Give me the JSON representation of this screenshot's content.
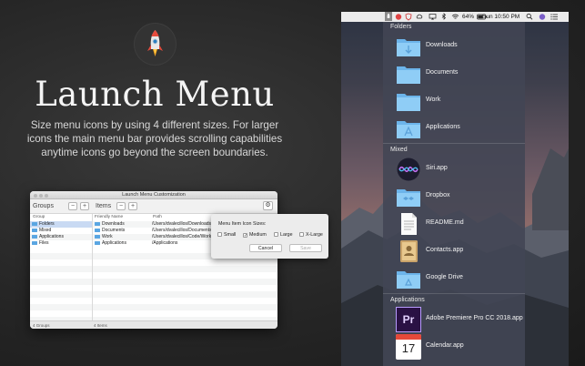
{
  "promo": {
    "title": "Launch Menu",
    "description": "Size menu icons by using 4 different sizes. For larger icons the main menu bar provides scrolling capabilities anytime icons go beyond the screen boundaries."
  },
  "window": {
    "title": "Launch Menu Customization",
    "groups_label": "Groups",
    "items_label": "Items",
    "minus": "−",
    "plus": "+",
    "gear": "⚙",
    "group_column": "Group",
    "item_columns": [
      "Friendly Name",
      "Path"
    ],
    "groups": [
      "Folders",
      "Mixed",
      "Applications",
      "Files"
    ],
    "items": [
      {
        "name": "Downloads",
        "path": "/Users/dvalecillos/Downloads"
      },
      {
        "name": "Documents",
        "path": "/Users/dvalecillos/Documents"
      },
      {
        "name": "Work",
        "path": "/Users/dvalecillos/Code/Work"
      },
      {
        "name": "Applications",
        "path": "/Applications"
      }
    ],
    "status_groups": "4 Groups",
    "status_items": "4 Items"
  },
  "popover": {
    "heading": "Menu Item Icon Sizes:",
    "options": [
      "Small",
      "Medium",
      "Large",
      "X-Large"
    ],
    "selected": "Medium",
    "check": "✓",
    "cancel": "Cancel",
    "save": "Save"
  },
  "menubar": {
    "battery": "64%",
    "clock": "Sun 10:50 PM"
  },
  "menu": {
    "sections": [
      {
        "header": "Folders",
        "items": [
          "Downloads",
          "Documents",
          "Work",
          "Applications"
        ]
      },
      {
        "header": "Mixed",
        "items": [
          "Siri.app",
          "Dropbox",
          "README.md",
          "Contacts.app",
          "Google Drive"
        ]
      },
      {
        "header": "Applications",
        "items": [
          "Adobe Premiere Pro CC 2018.app",
          "Calendar.app"
        ]
      }
    ],
    "premiere_badge": "Pr",
    "calendar_day": "17"
  },
  "colors": {
    "folder_blue": "#7ec3f2",
    "selection": "#c9daf3",
    "premiere": "#2a1144"
  }
}
